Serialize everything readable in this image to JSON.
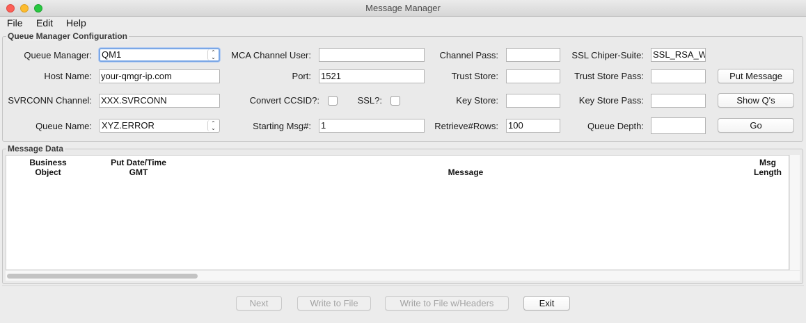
{
  "window": {
    "title": "Message Manager"
  },
  "menu": {
    "items": [
      "File",
      "Edit",
      "Help"
    ]
  },
  "config": {
    "group_title": "Queue Manager Configuration",
    "queue_manager": {
      "label": "Queue Manager:",
      "value": "QM1"
    },
    "mca_channel_user": {
      "label": "MCA Channel User:",
      "value": ""
    },
    "channel_pass": {
      "label": "Channel Pass:",
      "value": ""
    },
    "ssl_cipher_suite": {
      "label": "SSL Chiper-Suite:",
      "value": "SSL_RSA_WI"
    },
    "host_name": {
      "label": "Host Name:",
      "value": "your-qmgr-ip.com"
    },
    "port": {
      "label": "Port:",
      "value": "1521"
    },
    "trust_store": {
      "label": "Trust Store:",
      "value": ""
    },
    "trust_store_pass": {
      "label": "Trust Store Pass:",
      "value": ""
    },
    "svrconn_channel": {
      "label": "SVRCONN Channel:",
      "value": "XXX.SVRCONN"
    },
    "convert_ccsid": {
      "label": "Convert CCSID?:",
      "checked": false
    },
    "ssl": {
      "label": "SSL?:",
      "checked": false
    },
    "key_store": {
      "label": "Key Store:",
      "value": ""
    },
    "key_store_pass": {
      "label": "Key Store Pass:",
      "value": ""
    },
    "queue_name": {
      "label": "Queue Name:",
      "value": "XYZ.ERROR"
    },
    "starting_msg": {
      "label": "Starting Msg#:",
      "value": "1"
    },
    "retrieve_rows": {
      "label": "Retrieve#Rows:",
      "value": "100"
    },
    "queue_depth": {
      "label": "Queue Depth:",
      "value": ""
    },
    "buttons": {
      "put_message": "Put Message",
      "show_qs": "Show Q's",
      "go": "Go"
    }
  },
  "message_data": {
    "group_title": "Message Data",
    "columns": {
      "business_object": [
        "Business",
        "Object"
      ],
      "put_datetime": [
        "Put Date/Time",
        "GMT"
      ],
      "message": "Message",
      "msg_length": [
        "Msg",
        "Length"
      ]
    },
    "rows": []
  },
  "footer": {
    "next": "Next",
    "write_to_file": "Write to File",
    "write_to_file_headers": "Write to File w/Headers",
    "exit": "Exit"
  }
}
